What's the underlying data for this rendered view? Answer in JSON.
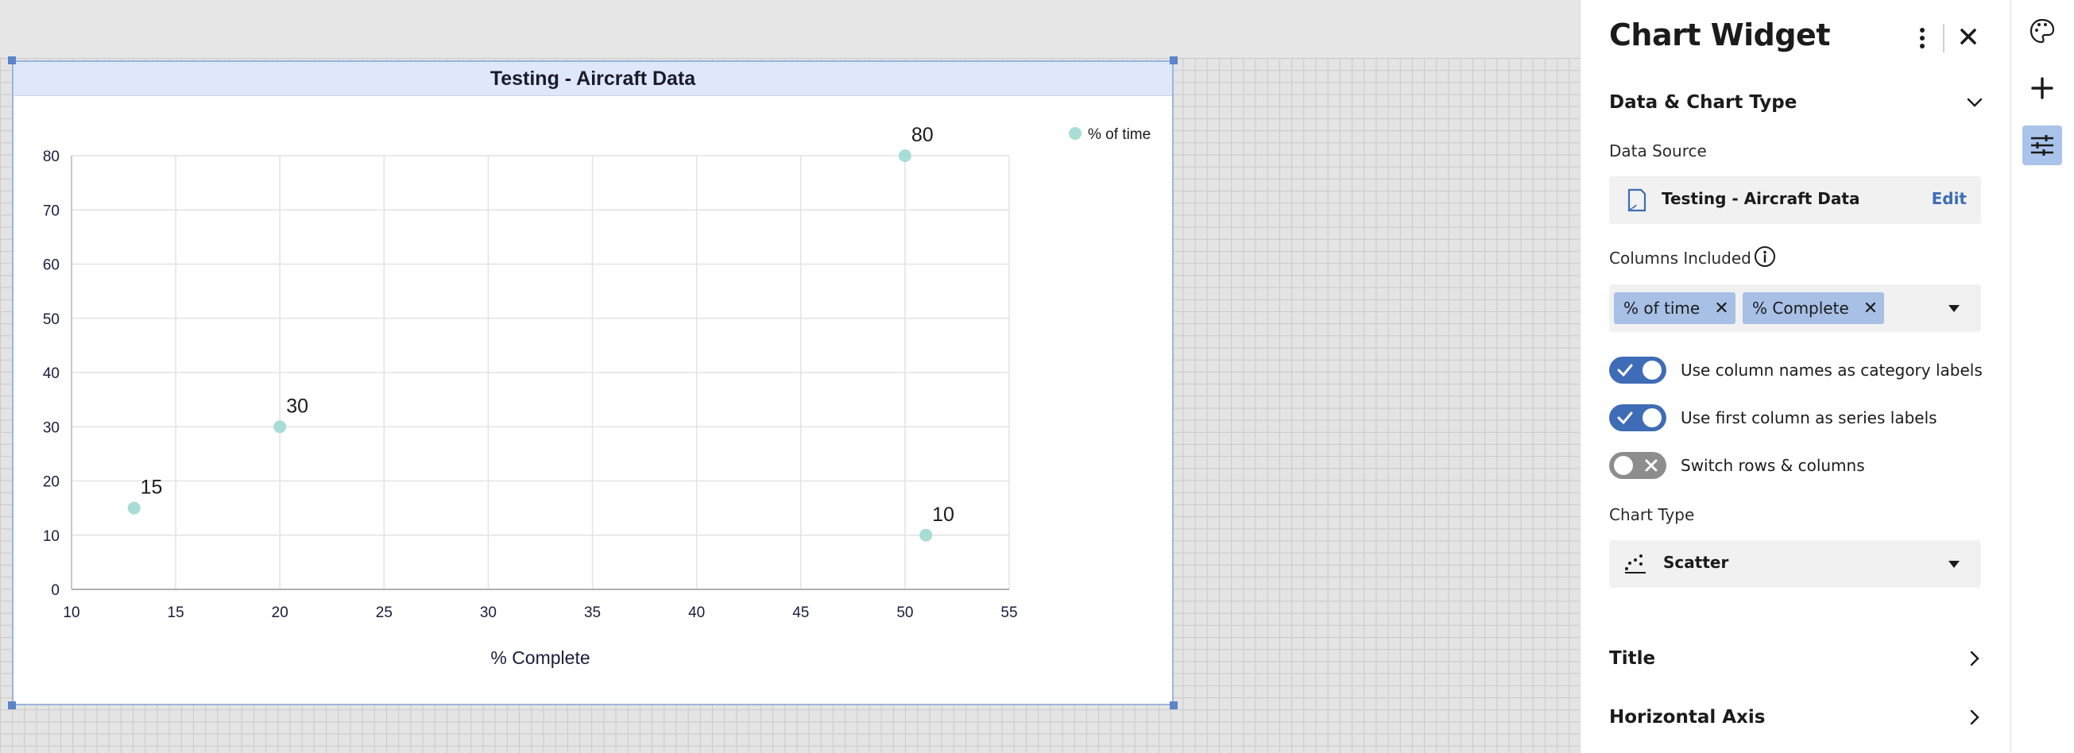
{
  "widget": {
    "title": "Testing - Aircraft Data"
  },
  "chart_data": {
    "type": "scatter",
    "title": "Testing - Aircraft Data",
    "xlabel": "% Complete",
    "ylabel": "",
    "xlim": [
      10,
      55
    ],
    "ylim": [
      0,
      80
    ],
    "x_ticks": [
      10,
      15,
      20,
      25,
      30,
      35,
      40,
      45,
      50,
      55
    ],
    "y_ticks": [
      0,
      10,
      20,
      30,
      40,
      50,
      60,
      70,
      80
    ],
    "grid": true,
    "legend_position": "top-right",
    "series": [
      {
        "name": "% of time",
        "color": "#a8ddd6",
        "points": [
          {
            "x": 13,
            "y": 15,
            "label": "15"
          },
          {
            "x": 20,
            "y": 30,
            "label": "30"
          },
          {
            "x": 50,
            "y": 80,
            "label": "80"
          },
          {
            "x": 51,
            "y": 10,
            "label": "10"
          }
        ]
      }
    ]
  },
  "panel": {
    "title": "Chart Widget",
    "section_data": "Data & Chart Type",
    "data_source_label": "Data Source",
    "data_source_name": "Testing - Aircraft Data",
    "edit_label": "Edit",
    "columns_label": "Columns Included",
    "columns": [
      {
        "label": "% of time"
      },
      {
        "label": "% Complete"
      }
    ],
    "toggles": [
      {
        "label": "Use column names as category labels",
        "on": true
      },
      {
        "label": "Use first column as series labels",
        "on": true
      },
      {
        "label": "Switch rows & columns",
        "on": false
      }
    ],
    "chart_type_label": "Chart Type",
    "chart_type_value": "Scatter",
    "section_title": "Title",
    "section_haxis": "Horizontal Axis"
  },
  "icons": {
    "toolbar": [
      "palette-icon",
      "plus-icon",
      "settings-sliders-icon"
    ],
    "accent": "#3e6cb7"
  }
}
